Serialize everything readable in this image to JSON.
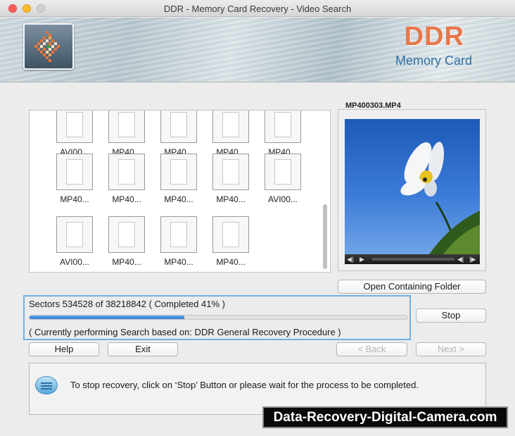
{
  "window": {
    "title": "DDR - Memory Card Recovery - Video Search"
  },
  "banner": {
    "brand": "DDR",
    "subtitle": "Memory Card"
  },
  "files": {
    "items": [
      {
        "label": "AVI00...",
        "col": 0,
        "row": 0
      },
      {
        "label": "MP40...",
        "col": 1,
        "row": 0
      },
      {
        "label": "MP40...",
        "col": 2,
        "row": 0
      },
      {
        "label": "MP40...",
        "col": 3,
        "row": 0
      },
      {
        "label": "MP40...",
        "col": 4,
        "row": 0
      },
      {
        "label": "MP40...",
        "col": 0,
        "row": 1
      },
      {
        "label": "MP40...",
        "col": 1,
        "row": 1
      },
      {
        "label": "MP40...",
        "col": 2,
        "row": 1
      },
      {
        "label": "MP40...",
        "col": 3,
        "row": 1
      },
      {
        "label": "AVI00...",
        "col": 4,
        "row": 1
      },
      {
        "label": "AVI00...",
        "col": 0,
        "row": 2
      },
      {
        "label": "MP40...",
        "col": 1,
        "row": 2
      },
      {
        "label": "MP40...",
        "col": 2,
        "row": 2
      },
      {
        "label": "MP40...",
        "col": 3,
        "row": 2
      }
    ]
  },
  "preview": {
    "filename": "MP400303.MP4",
    "open_folder_label": "Open Containing Folder"
  },
  "progress": {
    "sectors_text": "Sectors 534528 of 38218842    ( Completed 41% )",
    "percent": 41,
    "currently_text": "( Currently performing Search based on: DDR General Recovery Procedure )"
  },
  "buttons": {
    "stop": "Stop",
    "help": "Help",
    "exit": "Exit",
    "back": "< Back",
    "next": "Next >"
  },
  "info": {
    "message": "To stop recovery, click on ‘Stop’ Button or please wait for the process to be completed."
  },
  "watermark": "Data-Recovery-Digital-Camera.com",
  "colors": {
    "brand": "#e8774a",
    "subtitle": "#2c6fa6",
    "progress_fill": "#2f7fd8",
    "focus_border": "#6fb1e4"
  }
}
